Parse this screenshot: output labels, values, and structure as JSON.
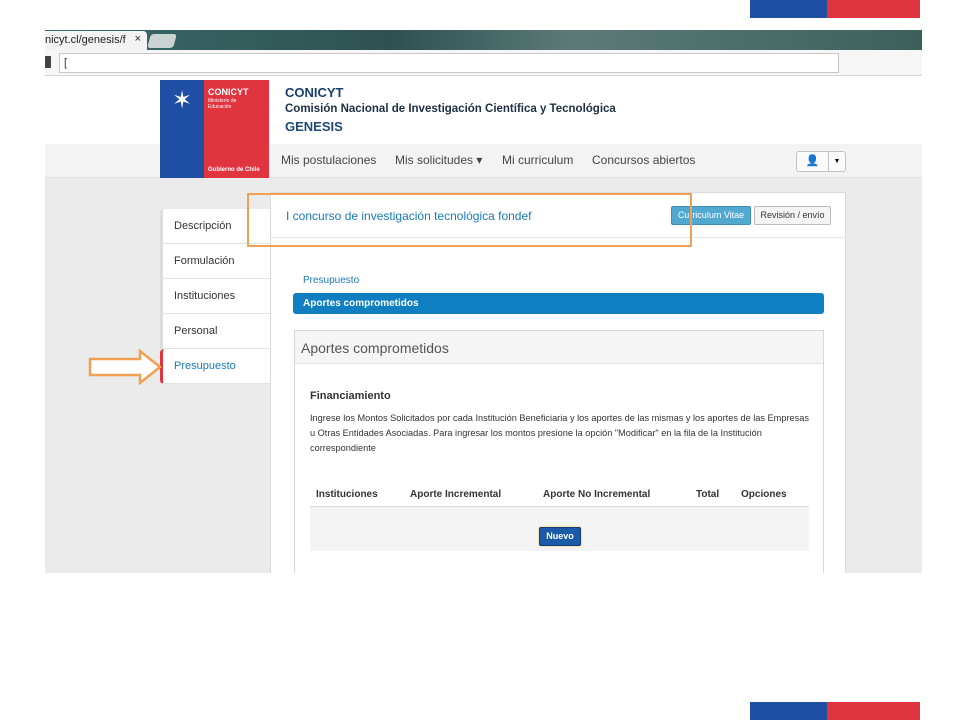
{
  "browser": {
    "tab_title": "nicyt.cl/genesis/f",
    "tab_close": "×",
    "address_value": "["
  },
  "logo": {
    "crest_glyph": "✶",
    "name": "CONICYT",
    "ministerio": "Ministerio de Educación",
    "gobierno": "Gobierno de Chile"
  },
  "header": {
    "title": "CONICYT",
    "subtitle": "Comisión Nacional de Investigación Científica y Tecnológica",
    "app": "GENESIS"
  },
  "nav": {
    "items": [
      {
        "label": "Mis postulaciones"
      },
      {
        "label": "Mis solicitudes ▾"
      },
      {
        "label": "Mi curriculum"
      },
      {
        "label": "Concursos abiertos"
      }
    ],
    "user_icon": "👤",
    "user_caret": "▼"
  },
  "side_tabs": [
    {
      "label": "Descripción"
    },
    {
      "label": "Formulación"
    },
    {
      "label": "Instituciones"
    },
    {
      "label": "Personal"
    },
    {
      "label": "Presupuesto",
      "active": true
    }
  ],
  "panel": {
    "title": "I concurso de investigación tecnológica fondef",
    "cv_button": "Curriculum Vitae",
    "review_button": "Revisión / envío",
    "crumb": "Presupuesto",
    "active_section": "Aportes comprometidos"
  },
  "inner": {
    "heading": "Aportes comprometidos",
    "fin_title": "Financiamiento",
    "fin_desc": "Ingrese los Montos Solicitados por cada Institución Beneficiaria y los aportes de las mismas y los aportes de las Empresas u Otras Entidades Asociadas. Para ingresar los montos presione la opción \"Modificar\" en la fila de la Institución correspondiente",
    "columns": [
      "Instituciones",
      "Aporte Incremental",
      "Aporte No Incremental",
      "Total",
      "Opciones"
    ],
    "new_button": "Nuevo"
  },
  "colors": {
    "flag_blue": "#1f4fa5",
    "flag_red": "#e0343f",
    "accent": "#0f7fc2",
    "highlight": "#f0a050"
  }
}
